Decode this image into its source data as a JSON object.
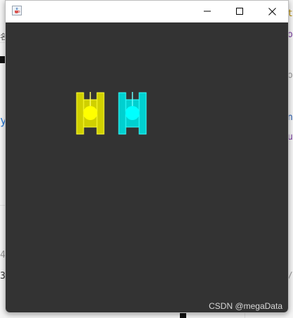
{
  "window": {
    "title": "",
    "app_icon": "java-cup-icon",
    "controls": {
      "minimize_icon": "minimize-icon",
      "maximize_icon": "maximize-icon",
      "close_icon": "close-icon"
    }
  },
  "game": {
    "background_color": "#333333",
    "tanks": [
      {
        "name": "yellow-tank",
        "color": "#ffff00",
        "body_color": "#d0d000",
        "direction": "up"
      },
      {
        "name": "cyan-tank",
        "color": "#00ffff",
        "body_color": "#00d0d0",
        "direction": "up"
      }
    ]
  },
  "watermark": "CSDN @megaData"
}
